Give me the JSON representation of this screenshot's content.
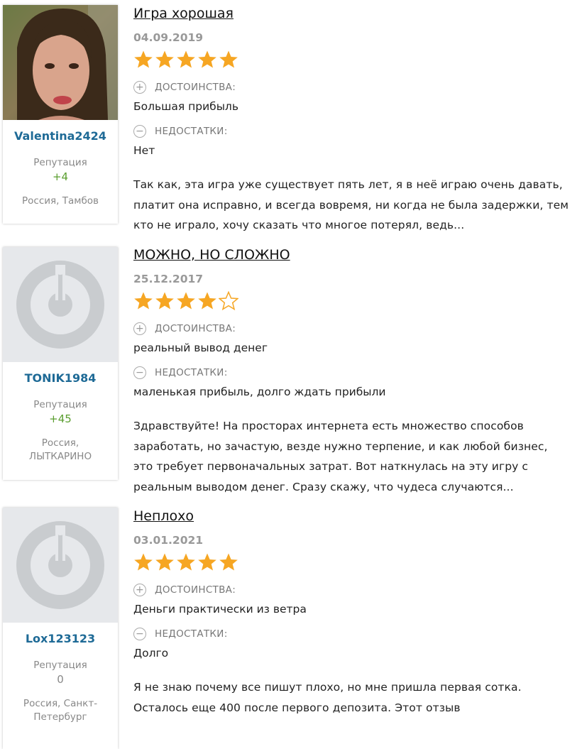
{
  "reviews": [
    {
      "user": {
        "name": "Valentina2424",
        "reputation_label": "Репутация",
        "reputation": "+4",
        "location": "Россия, Тамбов",
        "has_photo": true
      },
      "title": "Игра хорошая",
      "date": "04.09.2019",
      "rating": 5,
      "pros_label": "ДОСТОИНСТВА:",
      "pros": "Большая прибыль",
      "cons_label": "НЕДОСТАТКИ:",
      "cons": "Нет",
      "text": "Так как, эта игра уже существует пять лет, я в неё играю очень давать, платит она исправно, и всегда вовремя, ни когда не была задержки, тем кто не играло, хочу сказать что многое потерял, ведь..."
    },
    {
      "user": {
        "name": "TONIK1984",
        "reputation_label": "Репутация",
        "reputation": "+45",
        "location": "Россия, ЛЫТКАРИНО",
        "has_photo": false
      },
      "title": "МОЖНО, НО СЛОЖНО",
      "date": "25.12.2017",
      "rating": 4,
      "pros_label": "ДОСТОИНСТВА:",
      "pros": "реальный вывод денег",
      "cons_label": "НЕДОСТАТКИ:",
      "cons": "маленькая прибыль, долго ждать прибыли",
      "text": "Здравствуйте! На просторах интернета есть множество способов заработать, но зачастую, везде нужно терпение, и как любой бизнес, это требует первоначальных затрат. Вот наткнулась на эту игру с реальным выводом денег. Сразу скажу, что чудеса случаются..."
    },
    {
      "user": {
        "name": "Lox123123",
        "reputation_label": "Репутация",
        "reputation": "0",
        "location": "Россия, Санкт-Петербург",
        "has_photo": false
      },
      "title": "Неплохо",
      "date": "03.01.2021",
      "rating": 5,
      "pros_label": "ДОСТОИНСТВА:",
      "pros": "Деньги практически из ветра",
      "cons_label": "НЕДОСТАТКИ:",
      "cons": "Долго",
      "text": "Я не знаю почему все пишут плохо, но мне пришла первая сотка. Осталось еще 400 после первого депозита. Этот отзыв"
    }
  ],
  "colors": {
    "star": "#f6a623",
    "username": "#1e6a96",
    "rep_positive": "#5a9e2f",
    "rep_zero": "#888888"
  },
  "icons": {
    "plus": "plus-circle-icon",
    "minus": "minus-circle-icon",
    "star": "star-icon",
    "avatar_placeholder": "default-avatar-icon"
  }
}
